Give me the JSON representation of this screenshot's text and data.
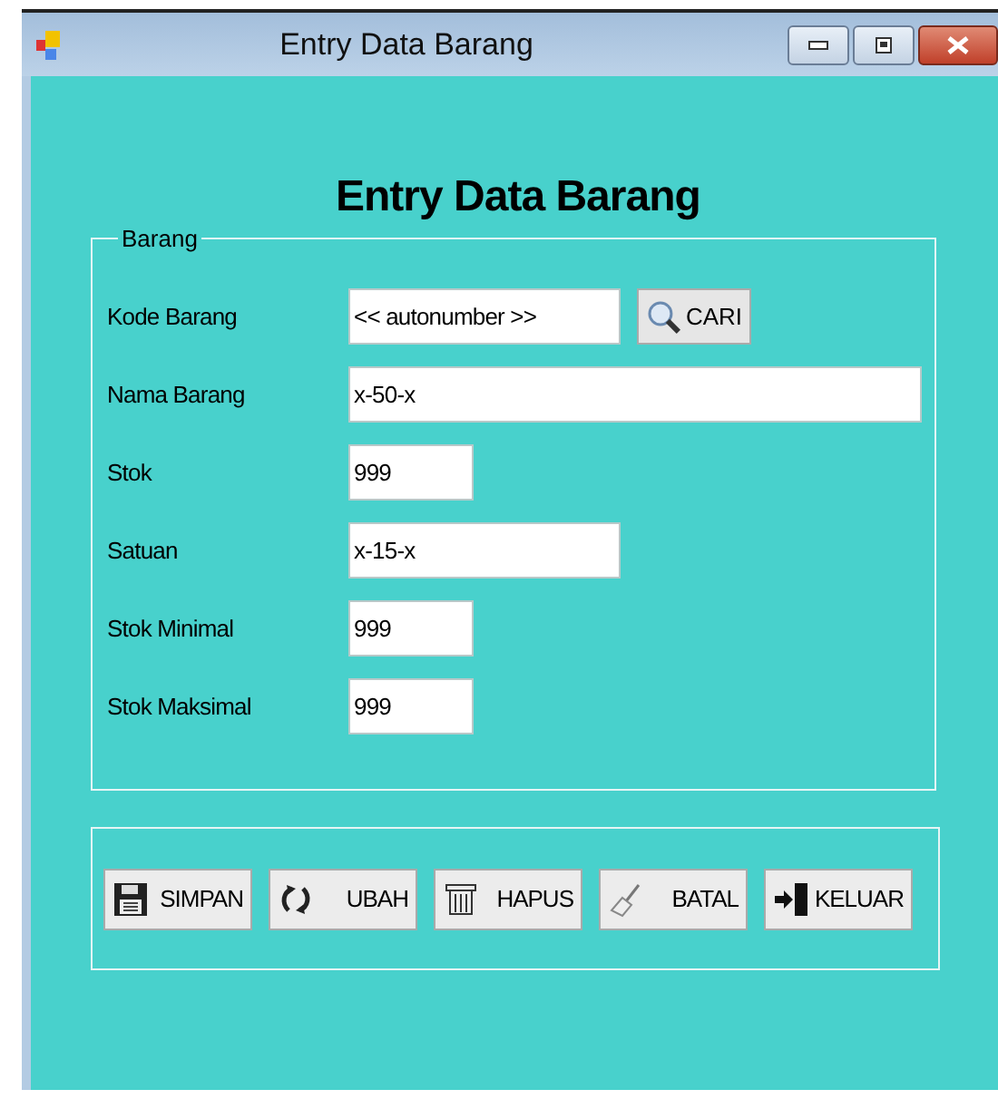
{
  "window": {
    "title": "Entry Data Barang"
  },
  "heading": "Entry Data Barang",
  "group": {
    "title": "Barang",
    "fields": [
      {
        "label": "Kode Barang",
        "value": "<< autonumber >>",
        "button": "CARI"
      },
      {
        "label": "Nama Barang",
        "value": "x-50-x"
      },
      {
        "label": "Stok",
        "value": "999"
      },
      {
        "label": "Satuan",
        "value": "x-15-x"
      },
      {
        "label": "Stok Minimal",
        "value": "999"
      },
      {
        "label": "Stok Maksimal",
        "value": "999"
      }
    ]
  },
  "buttons": [
    {
      "label": "SIMPAN",
      "kind": "save"
    },
    {
      "label": "UBAH",
      "kind": "edit"
    },
    {
      "label": "HAPUS",
      "kind": "delete"
    },
    {
      "label": "BATAL",
      "kind": "cancel"
    },
    {
      "label": "KELUAR",
      "kind": "exit"
    }
  ]
}
